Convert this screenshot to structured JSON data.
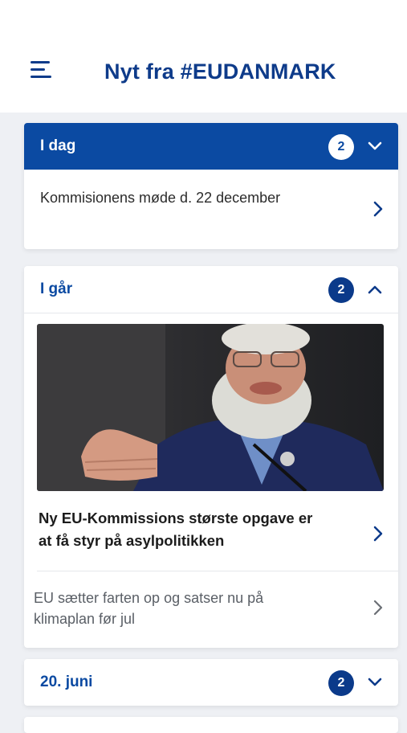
{
  "header": {
    "title": "Nyt fra #EUDANMARK",
    "menu_icon": "hamburger-menu-icon"
  },
  "colors": {
    "brand_blue": "#0b4aa2",
    "dark_blue": "#0e3b8a",
    "background": "#eef0f4"
  },
  "sections": [
    {
      "title": "I dag",
      "count": "2",
      "state": "collapsed-active",
      "items": [
        {
          "text": "Kommisionens møde d. 22 december"
        }
      ]
    },
    {
      "title": "I går",
      "count": "2",
      "state": "expanded",
      "featured": {
        "image": "photo of speaker with white beard and glasses gesturing",
        "text": "Ny EU-Kommissions største opgave er at få styr på asylpolitikken"
      },
      "items": [
        {
          "text": "EU sætter farten op og satser nu på klimaplan før jul"
        }
      ]
    },
    {
      "title": "20. juni",
      "count": "2",
      "state": "collapsed"
    }
  ]
}
